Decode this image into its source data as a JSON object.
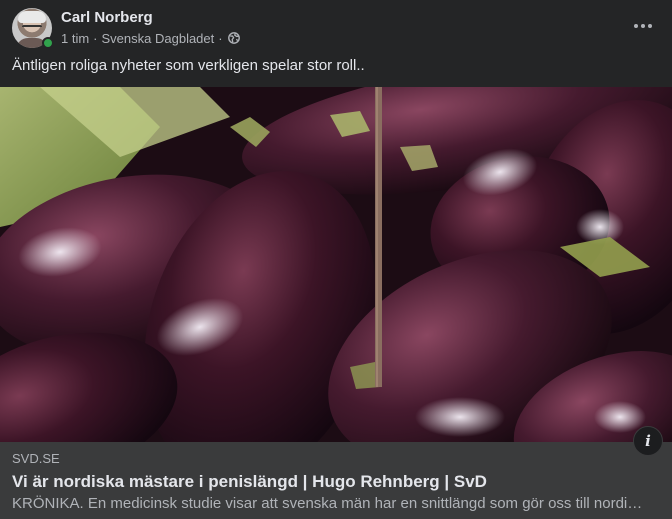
{
  "post": {
    "author": "Carl Norberg",
    "time": "1 tim",
    "source": "Svenska Dagbladet",
    "separator": "·",
    "privacy_icon": "globe-icon",
    "menu_icon": "more-horizontal-icon",
    "text": "Äntligen roliga nyheter som verkligen spelar stor roll..",
    "author_online": true
  },
  "link_preview": {
    "image_subject": "eggplants",
    "domain": "SVD.SE",
    "title": "Vi är nordiska mästare i penislängd | Hugo Rehnberg | SvD",
    "description": "KRÖNIKA. En medicinsk studie visar att svenska män har en snittlängd som gör oss till nordiska mästare.",
    "info_icon": "info-icon"
  },
  "colors": {
    "card_background": "#242526",
    "link_footer_background": "#3a3b3c",
    "primary_text": "#e4e6eb",
    "secondary_text": "#b0b3b8",
    "online_indicator": "#31a24c"
  }
}
